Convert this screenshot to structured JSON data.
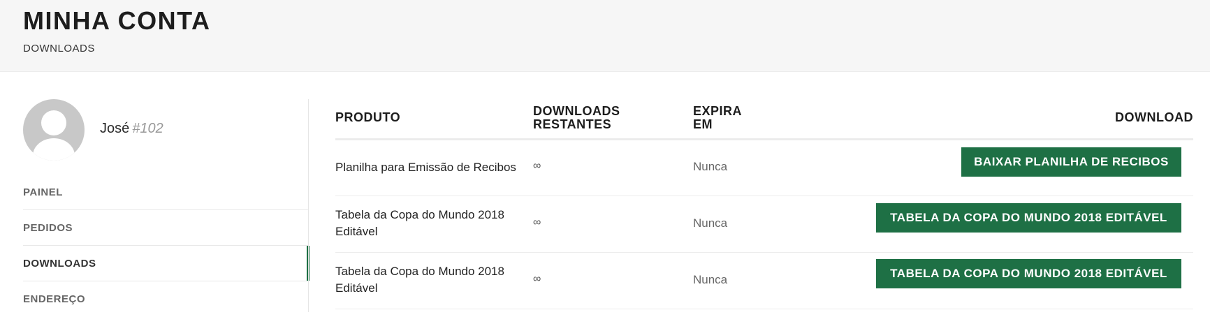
{
  "header": {
    "title": "MINHA CONTA",
    "breadcrumb": "DOWNLOADS"
  },
  "user": {
    "name": "José",
    "id": "#102"
  },
  "nav": {
    "items": [
      {
        "label": "PAINEL"
      },
      {
        "label": "PEDIDOS"
      },
      {
        "label": "DOWNLOADS",
        "active": true
      },
      {
        "label": "ENDEREÇO"
      }
    ]
  },
  "table": {
    "headers": {
      "product": "PRODUTO",
      "remaining_line1": "DOWNLOADS",
      "remaining_line2": "RESTANTES",
      "expires_line1": "EXPIRA",
      "expires_line2": "EM",
      "download": "DOWNLOAD"
    },
    "rows": [
      {
        "product": "Planilha para Emissão de Recibos",
        "remaining": "∞",
        "expires": "Nunca",
        "button": "BAIXAR PLANILHA DE RECIBOS"
      },
      {
        "product": "Tabela da Copa do Mundo 2018 Editável",
        "remaining": "∞",
        "expires": "Nunca",
        "button": "TABELA DA COPA DO MUNDO 2018 EDITÁVEL"
      },
      {
        "product": "Tabela da Copa do Mundo 2018 Editável",
        "remaining": "∞",
        "expires": "Nunca",
        "button": "TABELA DA COPA DO MUNDO 2018 EDITÁVEL"
      }
    ]
  },
  "colors": {
    "accent": "#1e7045",
    "header_bg": "#f6f6f6"
  }
}
